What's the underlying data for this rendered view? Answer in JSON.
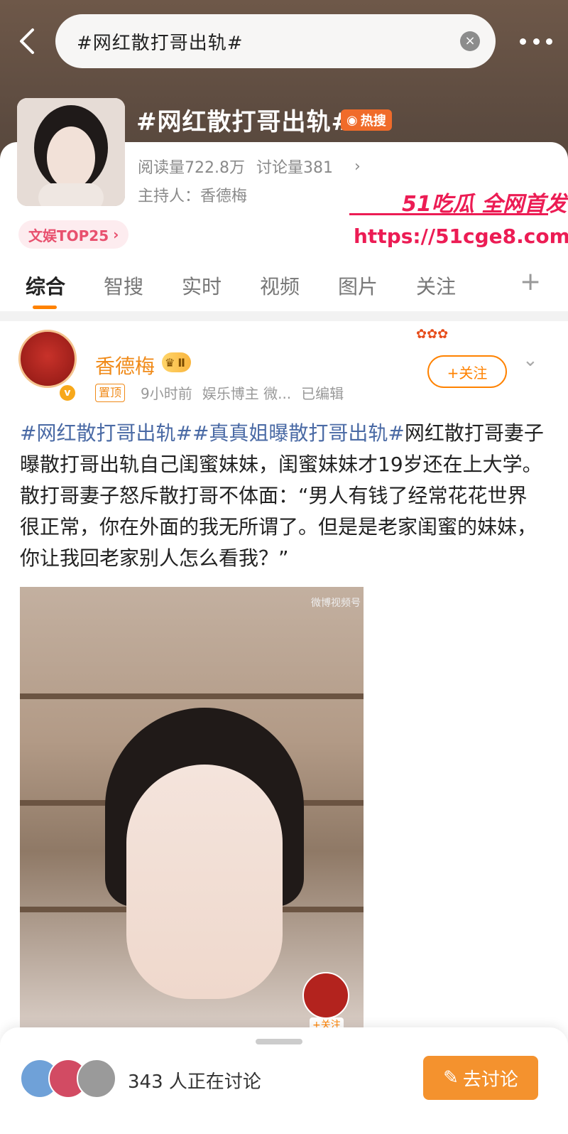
{
  "search": {
    "query": "#网红散打哥出轨#"
  },
  "topic": {
    "title": "#网红散打哥出轨#",
    "hot_label": "热搜",
    "reads": "阅读量722.8万",
    "discussions": "讨论量381",
    "host": "主持人：香德梅",
    "rank": "文娱TOP25"
  },
  "watermark": {
    "line1": "51吃瓜 全网首发",
    "line2": "https://51cge8.com"
  },
  "tabs": [
    "综合",
    "智搜",
    "实时",
    "视频",
    "图片",
    "关注"
  ],
  "post": {
    "author": "香德梅",
    "pin": "置顶",
    "time": "9小时前",
    "role": "娱乐博主 微...",
    "edited": "已编辑",
    "follow": "+关注",
    "tag1": "#网红散打哥出轨#",
    "tag2": "#真真姐曝散打哥出轨#",
    "body": "网红散打哥妻子曝散打哥出轨自己闺蜜妹妹，闺蜜妹妹才19岁还在上大学。散打哥妻子怒斥散打哥不体面：“男人有钱了经常花花世界很正常，你在外面的我无所谓了。但是是老家闺蜜的妹妹，你让我回老家别人怎么看我？”",
    "video_watermark": "微博视频号",
    "video_follow": "+关注"
  },
  "bottom": {
    "discussing": "343 人正在讨论",
    "discuss_button": "去讨论"
  },
  "colors": {
    "accent": "#ff8200",
    "link": "#4a6aa5",
    "watermark": "#ec1c54"
  }
}
